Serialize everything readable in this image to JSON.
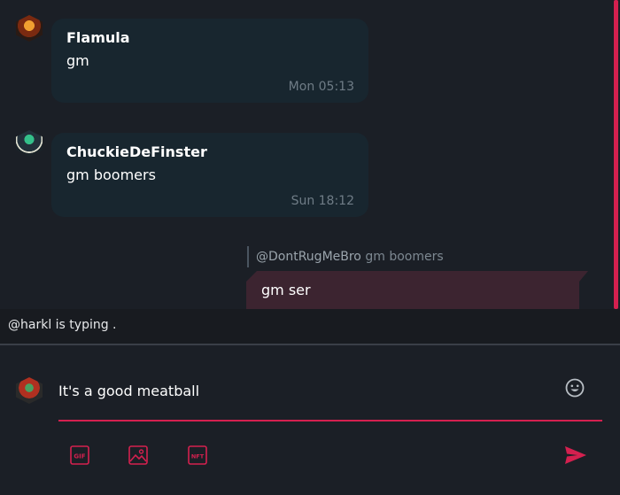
{
  "messages": [
    {
      "user": "Flamula",
      "text": "gm",
      "time": "Mon 05:13"
    },
    {
      "user": "ChuckieDeFinster",
      "text": "gm boomers",
      "time": "Sun 18:12"
    }
  ],
  "reply": {
    "mention": "@DontRugMeBro",
    "quoted_text": "gm boomers",
    "text": "gm ser"
  },
  "typing_indicator": "@harkl is typing .",
  "composer": {
    "value": "It's a good meatball"
  },
  "toolbar": {
    "gif": "GIF",
    "nft": "NFT"
  },
  "icons": [
    "emoji-icon",
    "gif-icon",
    "image-icon",
    "nft-icon",
    "send-icon"
  ],
  "colors": {
    "accent": "#d4204f",
    "bubble": "#18262f",
    "own_bubble": "#3c2430",
    "background": "#1b1f26"
  }
}
